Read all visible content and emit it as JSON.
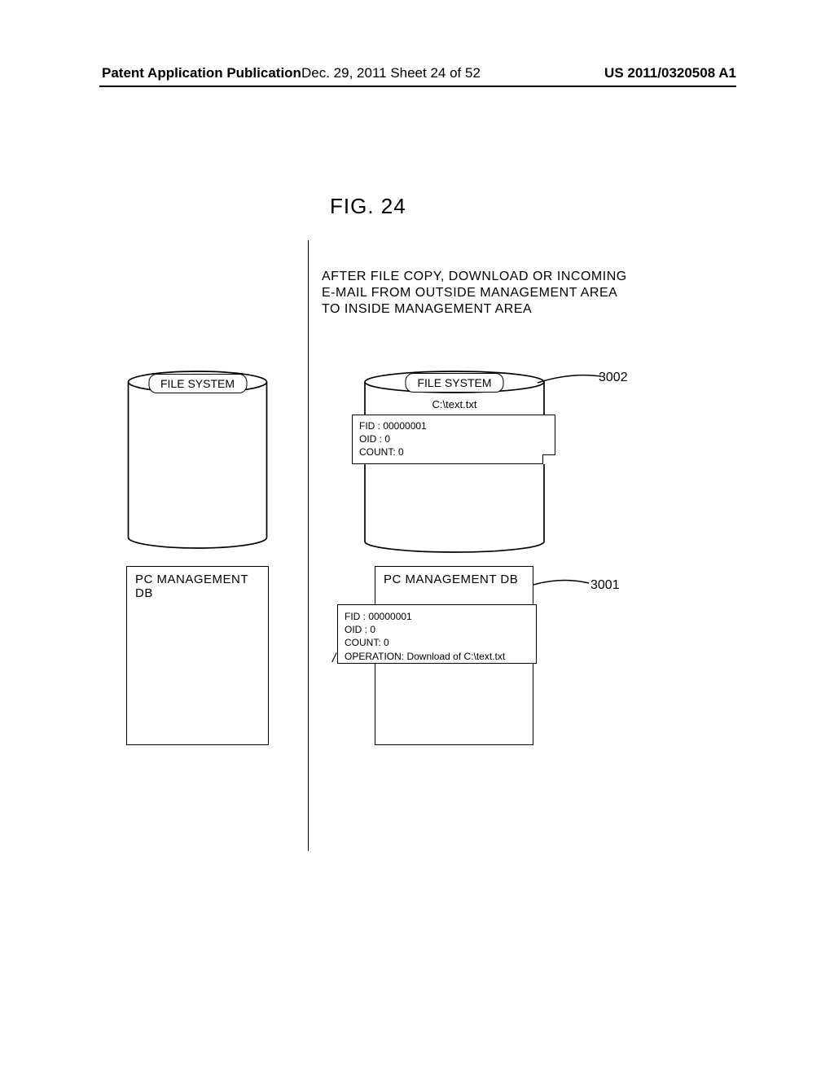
{
  "header": {
    "left": "Patent Application Publication",
    "center": "Dec. 29, 2011  Sheet 24 of 52",
    "right": "US 2011/0320508 A1"
  },
  "figure_title": "FIG. 24",
  "caption_lines": {
    "l1": "AFTER FILE COPY, DOWNLOAD OR INCOMING",
    "l2": "E-MAIL FROM OUTSIDE MANAGEMENT AREA",
    "l3": "TO INSIDE MANAGEMENT AREA"
  },
  "left": {
    "cylinder_label": "FILE SYSTEM",
    "db_title": "PC MANAGEMENT DB"
  },
  "right": {
    "cylinder_label": "FILE SYSTEM",
    "file_label": "C:\\text.txt",
    "note": {
      "fid": "FID   : 00000001",
      "oid": "OID  : 0",
      "count": "COUNT: 0"
    },
    "db_title": "PC MANAGEMENT DB",
    "record": {
      "fid": "FID   : 00000001",
      "oid": "OID  : 0",
      "count": "COUNT: 0",
      "operation": "OPERATION: Download of C:\\text.txt"
    }
  },
  "callouts": {
    "fs": "3002",
    "db": "3001"
  }
}
